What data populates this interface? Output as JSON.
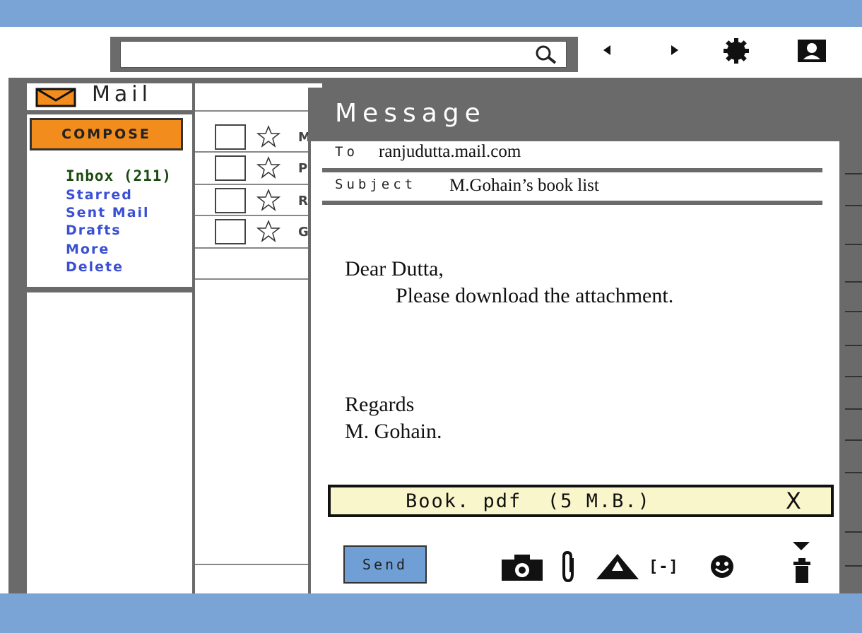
{
  "app": {
    "title": "Mail"
  },
  "toolbar": {
    "search_placeholder": "",
    "search_icon": "search-icon",
    "back_icon": "back-arrow-icon",
    "forward_icon": "forward-arrow-icon",
    "settings_icon": "gear-icon",
    "profile_icon": "profile-icon"
  },
  "sidebar": {
    "compose_label": "COMPOSE",
    "folders": [
      {
        "label": "Inbox (211)"
      },
      {
        "label": "Starred"
      },
      {
        "label": "Sent Mail"
      },
      {
        "label": "Drafts"
      },
      {
        "label": "More"
      },
      {
        "label": "Delete"
      }
    ]
  },
  "email_list": {
    "rows": [
      {
        "sender_initial": "M"
      },
      {
        "sender_initial": "P"
      },
      {
        "sender_initial": "R"
      },
      {
        "sender_initial": "G"
      }
    ]
  },
  "message": {
    "window_title": "Message",
    "to_label": "To",
    "to_value": "ranjudutta.mail.com",
    "subject_label": "Subject",
    "subject_value": "M.Gohain’s book list",
    "body": {
      "greeting": "Dear Dutta,",
      "line1": "Please download the attachment.",
      "closing": "Regards",
      "signature": "M. Gohain."
    },
    "attachment": {
      "name": "Book. pdf",
      "size": "(5 M.B.)",
      "remove_label": "X"
    },
    "send_label": "Send",
    "tools": {
      "camera": "camera-icon",
      "attach": "paperclip-icon",
      "drive": "drive-icon",
      "link_label": "[-]",
      "emoji": "emoji-icon",
      "more": "dropdown-icon",
      "trash": "trash-icon"
    }
  },
  "colors": {
    "top_bar": "#7aa4d6",
    "frame": "#6a6a6a",
    "compose": "#f28c1c",
    "send": "#6f9fd5",
    "attachment_bg": "#f9f6cc",
    "folder_link": "#3a4fd4",
    "inbox_text": "#1a4a10"
  }
}
